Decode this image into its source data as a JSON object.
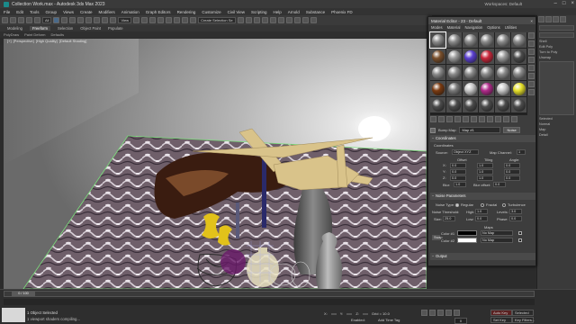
{
  "window": {
    "title": "Collection Work.max - Autodesk 3ds Max 2023",
    "workspaces_label": "Workspaces:",
    "workspace_value": "Default"
  },
  "menu": [
    "File",
    "Edit",
    "Tools",
    "Group",
    "Views",
    "Create",
    "Modifiers",
    "Animation",
    "Graph Editors",
    "Rendering",
    "Customize",
    "Civil View",
    "Scripting",
    "Help",
    "Arnold",
    "Substance",
    "Phoenix FD"
  ],
  "toolbar": {
    "selection_filter": "All",
    "view_dropdown": "View",
    "selection_set": "Create Selection Se"
  },
  "ribbon": {
    "tabs": [
      "Modeling",
      "Freeform",
      "Selection",
      "Object Paint",
      "Populate"
    ],
    "active": "Freeform",
    "sub": [
      "PolyDraw",
      "Paint Deform",
      "Defaults"
    ]
  },
  "viewport": {
    "labels": [
      "[+]",
      "[Perspective]",
      "[High Quality]",
      "[Default Shading]"
    ]
  },
  "material_editor": {
    "title": "Material Editor - 23 - Default",
    "menu": [
      "Modes",
      "Material",
      "Navigation",
      "Options",
      "Utilities"
    ],
    "slot_colors": [
      [
        "#8a8a8a",
        "#8a8a8a",
        "#8a8a8a",
        "#8a8a8a",
        "#8a8a8a",
        "#8a8a8a"
      ],
      [
        "#7a4f2b",
        "#9a9a9a",
        "#5a3fd0",
        "#c8263a",
        "#9a9a9a",
        "#4a4a4a"
      ],
      [
        "#8a8a8a",
        "#8a8a8a",
        "#8a8a8a",
        "#8a8a8a",
        "#8a8a8a",
        "#8a8a8a"
      ],
      [
        "#7a3a10",
        "#7a7a7a",
        "#c8c8c8",
        "#b02a8a",
        "#c8c8c8",
        "#e6e02a"
      ],
      [
        "#4b4b4b",
        "#4b4b4b",
        "#4b4b4b",
        "#4b4b4b",
        "#4b4b4b",
        "#4b4b4b"
      ]
    ],
    "bump_label": "Bump Map:",
    "bump_value": "Map #1",
    "noise_button": "Noise",
    "coordinates": {
      "rollout": "Coordinates",
      "sub": "Coordinates",
      "source_label": "Source:",
      "source_value": "Object XYZ",
      "map_channel_label": "Map Channel:",
      "map_channel_value": "1",
      "offset_label": "Offset",
      "tiling_label": "Tiling",
      "angle_label": "Angle:",
      "axes": [
        "X:",
        "Y:",
        "Z:"
      ],
      "offset": [
        "0.0",
        "0.0",
        "0.0"
      ],
      "tiling": [
        "1.0",
        "1.0",
        "1.0"
      ],
      "angle": [
        "0.0",
        "0.0",
        "0.0"
      ],
      "blur_label": "Blur:",
      "blur_value": "1.0",
      "blur_offset_label": "Blur offset:",
      "blur_offset_value": "0.0"
    },
    "noise": {
      "rollout": "Noise Parameters",
      "type_label": "Noise Type:",
      "types": [
        "Regular",
        "Fractal",
        "Turbulence"
      ],
      "threshold_label": "Noise Threshold:",
      "high_label": "High:",
      "high_value": "1.0",
      "levels_label": "Levels:",
      "levels_value": "3.0",
      "low_label": "Low:",
      "low_value": "0.0",
      "phase_label": "Phase:",
      "phase_value": "0.0",
      "size_label": "Size:",
      "size_value": "25.0",
      "swap": "Swap",
      "maps_label": "Maps",
      "color1_label": "Color #1",
      "color1": "#000000",
      "color2_label": "Color #2",
      "color2": "#ffffff",
      "no_map": "No Map"
    },
    "output_rollout": "Output"
  },
  "command_panel": {
    "labels": [
      "Shell",
      "Edit Poly",
      "Turn to Poly",
      "Unwrap",
      "Selected",
      "Normal",
      "Map",
      "Detail"
    ]
  },
  "status": {
    "time_thumb": "0 / 100",
    "line1": "1 Object Selected",
    "line2": "1 viewport shaders compiling...",
    "x_label": "X:",
    "x_value": "",
    "y_label": "Y:",
    "y_value": "",
    "z_label": "Z:",
    "z_value": "",
    "grid": "Grid = 10.0",
    "enabled": "Enabled:",
    "add_time_tag": "Add Time Tag",
    "auto_key": "Auto Key",
    "set_key": "Set Key",
    "selected": "Selected",
    "key_filters": "Key Filters...",
    "frame": "0"
  }
}
